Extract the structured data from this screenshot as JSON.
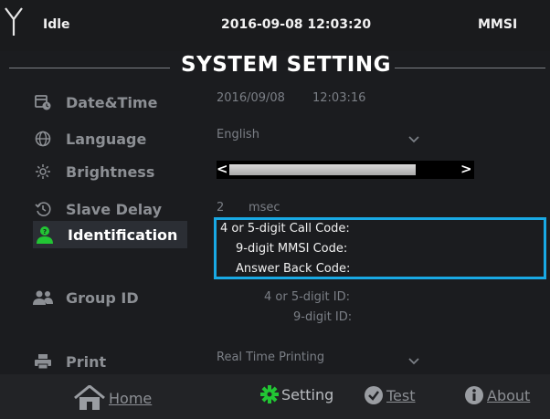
{
  "status_bar": {
    "status": "Idle",
    "datetime": "2016-09-08 12:03:20",
    "mode": "MMSI"
  },
  "page_title": "SYSTEM SETTING",
  "menu": {
    "date_time": "Date&Time",
    "language": "Language",
    "brightness": "Brightness",
    "slave_delay": "Slave Delay",
    "identification": "Identification",
    "group_id": "Group ID",
    "print": "Print"
  },
  "values": {
    "date": "2016/09/08",
    "time": "12:03:16",
    "language": "English",
    "brightness_level": 0.72,
    "brightness_dec": "<",
    "brightness_inc": ">",
    "slave_delay_value": "2",
    "slave_delay_unit": "msec",
    "print_mode": "Real Time Printing"
  },
  "identification": {
    "call_code_label": "4 or 5-digit Call Code:",
    "mmsi_code_label": "9-digit MMSI Code:",
    "answer_back_label": "Answer Back Code:"
  },
  "group_id": {
    "id_label": "4 or 5-digit ID:",
    "id9_label": "9-digit ID:"
  },
  "bottom_nav": {
    "home": "Home",
    "setting": "Setting",
    "test": "Test",
    "about": "About"
  },
  "colors": {
    "accent_blue": "#19a9e4",
    "active_green": "#22c534"
  },
  "icons": {
    "status": "antenna-icon",
    "date_time": "calendar-clock-icon",
    "language": "globe-icon",
    "brightness": "sun-icon",
    "slave_delay": "history-icon",
    "identification": "user-icon",
    "group_id": "group-icon",
    "print": "printer-icon",
    "home": "home-icon",
    "setting": "gear-icon",
    "test": "check-circle-icon",
    "about": "info-icon"
  }
}
